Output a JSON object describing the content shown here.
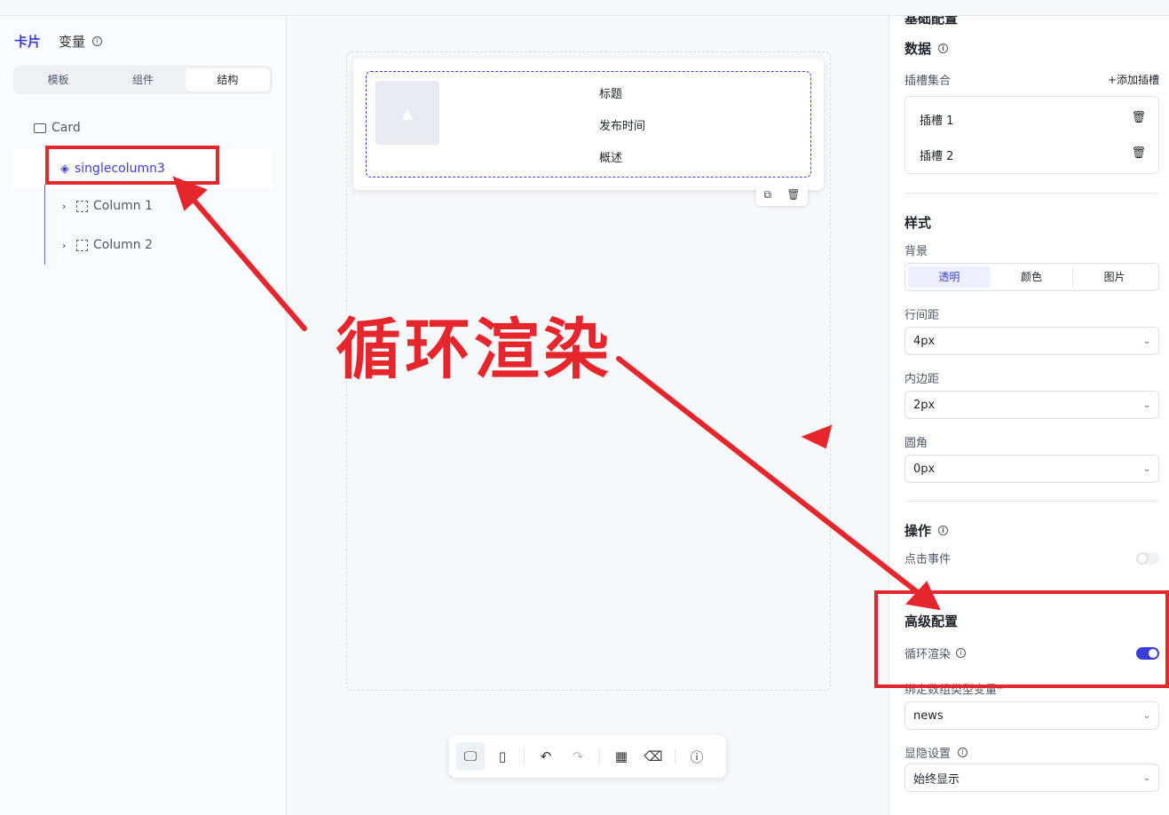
{
  "left_panel": {
    "tab_card": "卡片",
    "tab_variables": "变量",
    "segments": [
      "模板",
      "组件",
      "结构"
    ],
    "active_segment": "结构",
    "tree": {
      "root": "Card",
      "selected": "singlecolumn3",
      "children": [
        "Column 1",
        "Column 2"
      ]
    }
  },
  "canvas": {
    "card_fields": [
      "标题",
      "发布时间",
      "概述"
    ]
  },
  "right_panel": {
    "cut_heading": "基础配置",
    "data_heading": "数据",
    "slots_label": "插槽集合",
    "add_slot": "+添加插槽",
    "slots": [
      "插槽 1",
      "插槽 2"
    ],
    "style_heading": "样式",
    "background_label": "背景",
    "background_options": [
      "透明",
      "颜色",
      "图片"
    ],
    "background_selected": "透明",
    "line_spacing_label": "行间距",
    "line_spacing_value": "4px",
    "padding_label": "内边距",
    "padding_value": "2px",
    "radius_label": "圆角",
    "radius_value": "0px",
    "action_heading": "操作",
    "click_event_label": "点击事件",
    "click_event_enabled": false,
    "advanced_heading": "高级配置",
    "loop_render_label": "循环渲染",
    "loop_render_enabled": true,
    "bind_array_label": "绑定数组类型变量",
    "bind_array_value": "news",
    "visibility_label": "显隐设置",
    "visibility_value": "始终显示"
  },
  "annotation": {
    "text": "循环渲染",
    "color": "#e5262d"
  },
  "colors": {
    "accent": "#3b3ed6",
    "annotation_red": "#e5262d"
  }
}
